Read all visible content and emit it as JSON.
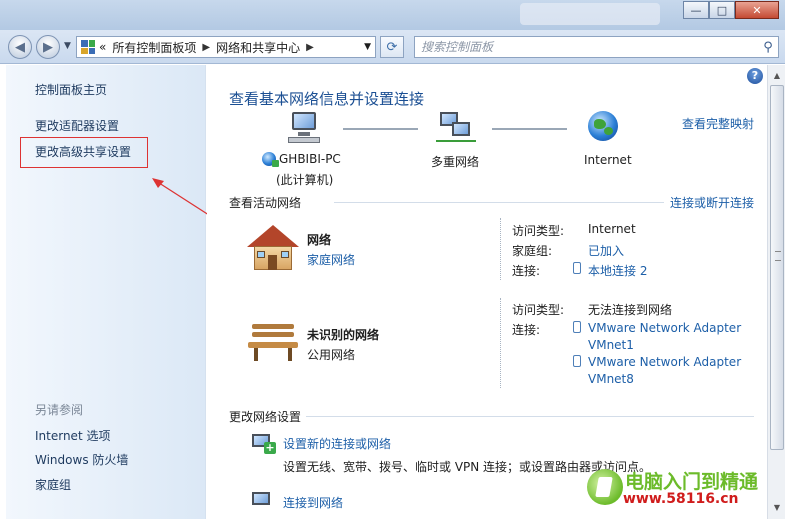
{
  "window": {
    "minimize_glyph": "—",
    "maximize_glyph": "□",
    "close_glyph": "✕"
  },
  "address_bar": {
    "prefix": "«",
    "crumbs": [
      "所有控制面板项",
      "网络和共享中心"
    ],
    "search_placeholder": "搜索控制面板"
  },
  "left_pane": {
    "links": [
      "控制面板主页",
      "更改适配器设置",
      "更改高级共享设置"
    ],
    "see_also_heading": "另请参阅",
    "see_also": [
      "Internet 选项",
      "Windows 防火墙",
      "家庭组"
    ]
  },
  "main": {
    "help_glyph": "?",
    "title": "查看基本网络信息并设置连接",
    "full_map_link": "查看完整映射",
    "map": {
      "computer_name": "GHBIBI-PC",
      "computer_sub": "(此计算机)",
      "middle": "多重网络",
      "internet": "Internet"
    },
    "active_networks": {
      "heading": "查看活动网络",
      "connect_link": "连接或断开连接",
      "networks": [
        {
          "name": "网络",
          "type": "家庭网络",
          "labels": [
            "访问类型:",
            "家庭组:",
            "连接:"
          ],
          "values": [
            "Internet",
            "已加入",
            "本地连接 2"
          ]
        },
        {
          "name": "未识别的网络",
          "type": "公用网络",
          "labels": [
            "访问类型:",
            "连接:"
          ],
          "values": [
            "无法连接到网络",
            "VMware Network Adapter",
            "VMnet1",
            "VMware Network Adapter",
            "VMnet8"
          ]
        }
      ]
    },
    "change_settings": {
      "heading": "更改网络设置",
      "tasks": [
        {
          "title": "设置新的连接或网络",
          "desc": "设置无线、宽带、拨号、临时或 VPN 连接；或设置路由器或访问点。"
        },
        {
          "title": "连接到网络",
          "desc": ""
        }
      ]
    }
  },
  "watermark": {
    "line1": "电脑入门到精通",
    "line2": "www.58116.cn"
  },
  "colors": {
    "link": "#1d5fa8",
    "title": "#1b4f93",
    "highlight": "#dd3333"
  }
}
